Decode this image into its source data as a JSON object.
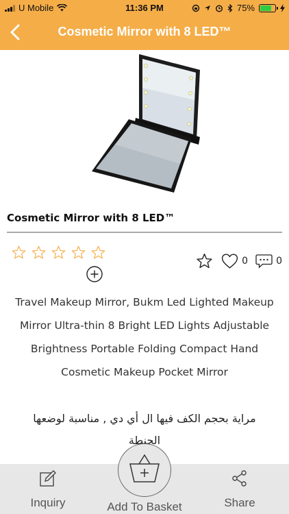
{
  "status_bar": {
    "carrier": "U Mobile",
    "time": "11:36 PM",
    "battery": "75%",
    "battery_level": 0.75
  },
  "nav": {
    "title": "Cosmetic Mirror with 8 LED™",
    "back_icon": "chevron-left-icon"
  },
  "product": {
    "title": "Cosmetic Mirror with 8 LED™",
    "rating_stars": 5,
    "rating_value": 0,
    "favorite_count": "0",
    "comment_count": "0",
    "description": "Travel Makeup Mirror, Bukm Led Lighted Makeup Mirror Ultra-thin 8 Bright LED Lights Adjustable Brightness Portable Folding Compact Hand Cosmetic Makeup Pocket Mirror",
    "description_ar": "مراية بحجم الكف فيها ال أي دي , مناسبة لوضعها الجنطة"
  },
  "bottom_bar": {
    "inquiry": "Inquiry",
    "add_to_basket": "Add To Basket",
    "share": "Share"
  },
  "colors": {
    "accent": "#f5ad48",
    "star": "#f5ad48"
  }
}
